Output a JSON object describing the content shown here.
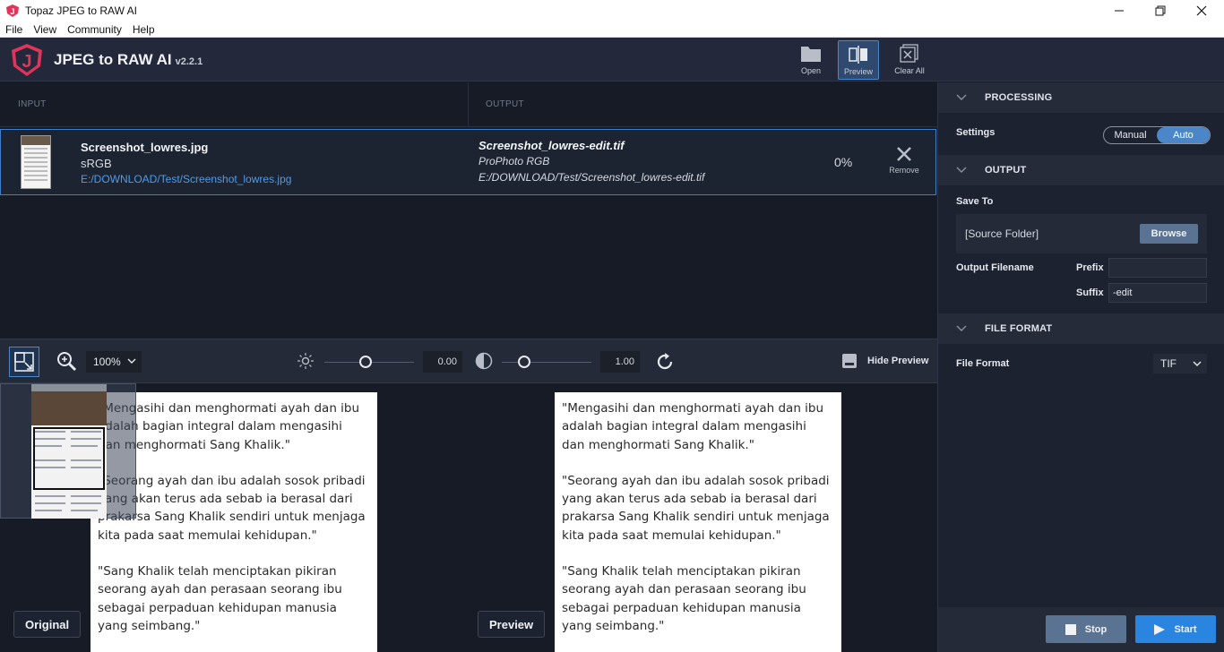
{
  "window": {
    "title": "Topaz JPEG to RAW AI"
  },
  "menu": {
    "items": [
      "File",
      "View",
      "Community",
      "Help"
    ]
  },
  "header": {
    "app_name": "JPEG to RAW AI",
    "version": "v2.2.1",
    "logo_letter": "J",
    "buttons": {
      "open": "Open",
      "preview": "Preview",
      "clear_all": "Clear All"
    }
  },
  "filelist": {
    "input_header": "INPUT",
    "output_header": "OUTPUT",
    "file": {
      "input_name": "Screenshot_lowres.jpg",
      "input_profile": "sRGB",
      "input_path": "E:/DOWNLOAD/Test/Screenshot_lowres.jpg",
      "output_name": "Screenshot_lowres-edit.tif",
      "output_profile": "ProPhoto RGB",
      "output_path": "E:/DOWNLOAD/Test/Screenshot_lowres-edit.tif",
      "progress": "0%",
      "remove_label": "Remove"
    }
  },
  "preview_toolbar": {
    "zoom": "100%",
    "exposure_value": "0.00",
    "contrast_value": "1.00",
    "hide_preview_label": "Hide Preview"
  },
  "preview": {
    "left_paragraphs": [
      "\"Mengasihi dan menghormati ayah dan ibu adalah bagian integral dalam mengasihi dan menghormati Sang Khalik.\"",
      "\"Seorang ayah dan ibu adalah sosok pribadi yang akan terus ada sebab ia berasal dari prakarsa Sang Khalik sendiri untuk menjaga kita pada saat memulai kehidupan.\"",
      "\"Sang Khalik telah menciptakan pikiran seorang ayah dan perasaan seorang ibu sebagai perpaduan kehidupan manusia yang seimbang.\""
    ],
    "right_paragraphs": [
      "\"Mengasihi dan menghormati ayah dan ibu adalah bagian integral dalam mengasihi dan menghormati Sang Khalik.\"",
      "\"Seorang ayah dan ibu adalah sosok pribadi yang akan terus ada sebab ia berasal dari prakarsa Sang Khalik sendiri untuk menjaga kita pada saat memulai kehidupan.\"",
      "\"Sang Khalik telah menciptakan pikiran seorang ayah dan perasaan seorang ibu sebagai perpaduan kehidupan manusia yang seimbang.\""
    ],
    "original_label": "Original",
    "preview_label": "Preview"
  },
  "sidepanel": {
    "processing": {
      "header": "PROCESSING",
      "settings_label": "Settings",
      "mode_manual": "Manual",
      "mode_auto": "Auto",
      "selected_mode": "Auto"
    },
    "output": {
      "header": "OUTPUT",
      "save_to_label": "Save To",
      "folder": "[Source Folder]",
      "browse_label": "Browse",
      "filename_label": "Output Filename",
      "prefix_label": "Prefix",
      "prefix_value": "",
      "suffix_label": "Suffix",
      "suffix_value": "-edit"
    },
    "file_format": {
      "header": "FILE FORMAT",
      "label": "File Format",
      "value": "TIF"
    }
  },
  "actions": {
    "stop_label": "Stop",
    "start_label": "Start"
  },
  "colors": {
    "accent": "#4a86c8",
    "start_button": "#2a85e0",
    "path_link": "#4f9be8",
    "logo": "#e0355a"
  }
}
